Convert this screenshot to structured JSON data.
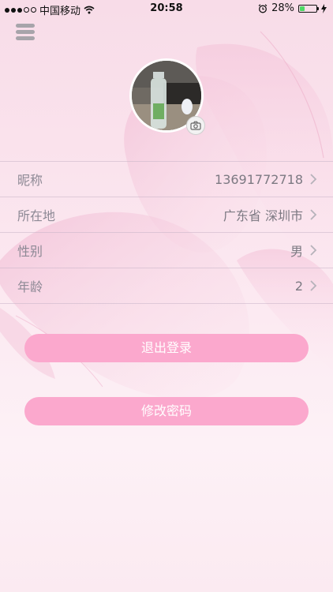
{
  "status_bar": {
    "carrier": "中国移动",
    "time": "20:58",
    "battery_percent": "28%",
    "battery_level": 0.28
  },
  "profile": {
    "rows": [
      {
        "label": "昵称",
        "value": "13691772718"
      },
      {
        "label": "所在地",
        "value": "广东省 深圳市"
      },
      {
        "label": "性别",
        "value": "男"
      },
      {
        "label": "年龄",
        "value": "2"
      }
    ]
  },
  "actions": {
    "logout_label": "退出登录",
    "change_password_label": "修改密码"
  },
  "colors": {
    "button_pink": "#fba8cd",
    "label_gray": "#8d8995"
  }
}
